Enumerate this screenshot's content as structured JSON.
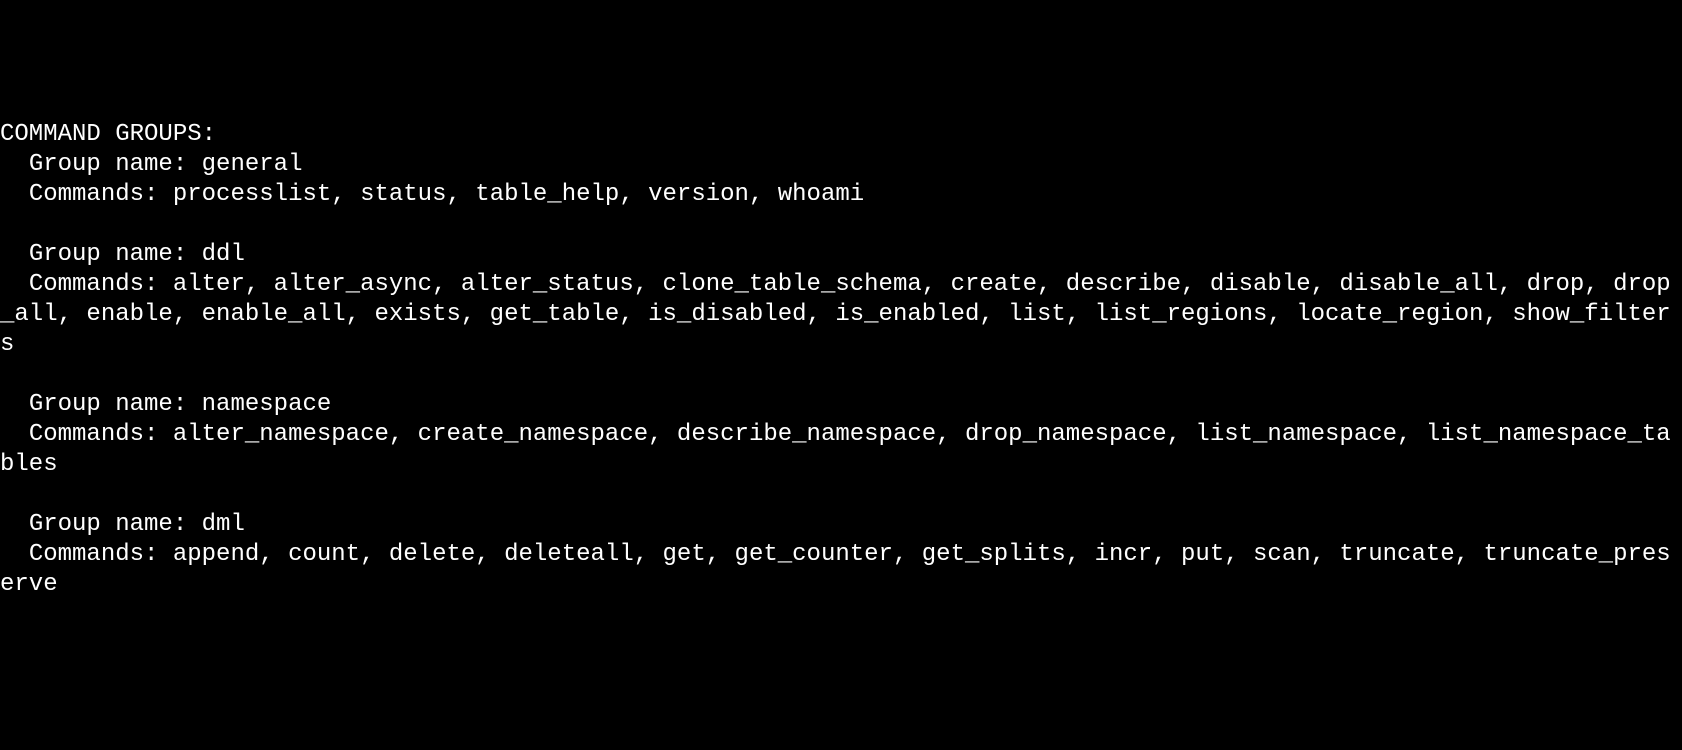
{
  "header": "COMMAND GROUPS:",
  "group_label": "Group name:",
  "commands_label": "Commands:",
  "groups": [
    {
      "name": "general",
      "commands": "processlist, status, table_help, version, whoami"
    },
    {
      "name": "ddl",
      "commands": "alter, alter_async, alter_status, clone_table_schema, create, describe, disable, disable_all, drop, drop_all, enable, enable_all, exists, get_table, is_disabled, is_enabled, list, list_regions, locate_region, show_filters"
    },
    {
      "name": "namespace",
      "commands": "alter_namespace, create_namespace, describe_namespace, drop_namespace, list_namespace, list_namespace_tables"
    },
    {
      "name": "dml",
      "commands": "append, count, delete, deleteall, get, get_counter, get_splits, incr, put, scan, truncate, truncate_preserve"
    }
  ]
}
